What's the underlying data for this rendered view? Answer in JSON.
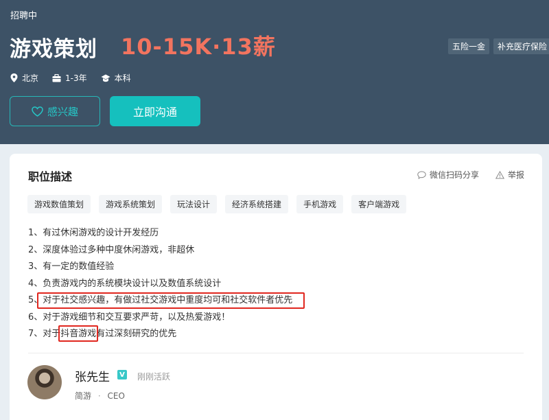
{
  "header": {
    "status": "招聘中",
    "job_title": "游戏策划",
    "salary": "10-15K·13薪",
    "benefits": [
      "五险一金",
      "补充医疗保险"
    ],
    "meta": {
      "location": "北京",
      "experience": "1-3年",
      "education": "本科"
    },
    "interest_label": "感兴趣",
    "chat_label": "立即沟通"
  },
  "card": {
    "section_title": "职位描述",
    "share_label": "微信扫码分享",
    "report_label": "举报",
    "tags": [
      "游戏数值策划",
      "游戏系统策划",
      "玩法设计",
      "经济系统搭建",
      "手机游戏",
      "客户端游戏"
    ],
    "description": [
      "1、有过休闲游戏的设计开发经历",
      "2、深度体验过多种中度休闲游戏，非超休",
      "3、有一定的数值经验",
      "4、负责游戏内的系统模块设计以及数值系统设计",
      "5、对于社交感兴趣，有做过社交游戏中重度均可和社交软件者优先",
      "6、对于游戏细节和交互要求严苛，以及热爱游戏！",
      "7、对于抖音游戏有过深刻研究的优先"
    ]
  },
  "recruiter": {
    "name": "张先生",
    "verified_mark": "V",
    "active_status": "刚刚活跃",
    "company": "简游",
    "separator": "·",
    "role": "CEO"
  },
  "colors": {
    "header_bg": "#3d5266",
    "salary": "#f2745f",
    "accent": "#15c0be",
    "highlight_box": "#e0261e"
  }
}
